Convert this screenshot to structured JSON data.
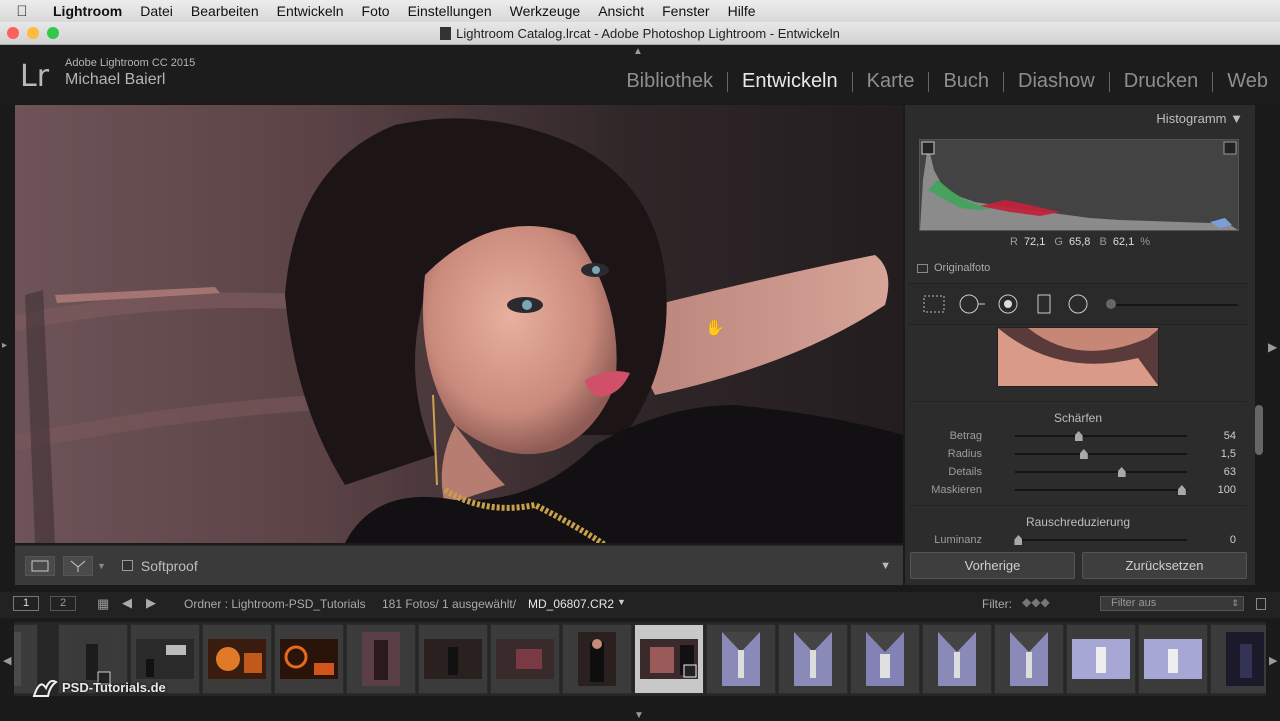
{
  "menubar": {
    "apple_icon": "apple-icon",
    "items": [
      "Lightroom",
      "Datei",
      "Bearbeiten",
      "Entwickeln",
      "Foto",
      "Einstellungen",
      "Werkzeuge",
      "Ansicht",
      "Fenster",
      "Hilfe"
    ]
  },
  "window": {
    "title": "Lightroom Catalog.lrcat - Adobe Photoshop Lightroom - Entwickeln"
  },
  "identity": {
    "logo": "Lr",
    "product": "Adobe Lightroom CC 2015",
    "user": "Michael Baierl"
  },
  "modules": [
    "Bibliothek",
    "Entwickeln",
    "Karte",
    "Buch",
    "Diashow",
    "Drucken",
    "Web"
  ],
  "active_module": "Entwickeln",
  "toolbar": {
    "softproof_label": "Softproof"
  },
  "panel": {
    "histogram_title": "Histogramm",
    "rgb": {
      "r_label": "R",
      "r": "72,1",
      "g_label": "G",
      "g": "65,8",
      "b_label": "B",
      "b": "62,1",
      "unit": "%"
    },
    "original_label": "Originalfoto",
    "sharpen": {
      "title": "Schärfen",
      "rows": [
        {
          "label": "Betrag",
          "value": "54",
          "level": 0.37
        },
        {
          "label": "Radius",
          "value": "1,5",
          "level": 0.4
        },
        {
          "label": "Details",
          "value": "63",
          "level": 0.62
        },
        {
          "label": "Maskieren",
          "value": "100",
          "level": 0.97
        }
      ]
    },
    "noise": {
      "title": "Rauschreduzierung",
      "rows": [
        {
          "label": "Luminanz",
          "value": "0",
          "level": 0.02
        }
      ]
    },
    "prev_button": "Vorherige",
    "reset_button": "Zurücksetzen"
  },
  "filmstrip_bar": {
    "view1": "1",
    "view2": "2",
    "source": "Ordner : Lightroom-PSD_Tutorials",
    "count": "181 Fotos/ 1 ausgewählt/",
    "filename": "MD_06807.CR2",
    "filter_label": "Filter:",
    "filter_value": "Filter aus"
  },
  "watermark": "PSD-Tutorials.de",
  "colors": {
    "accent_module": "#e8e8e8",
    "panel_bg": "#2c2c2c",
    "selected_cell": "#c8c8c8"
  }
}
